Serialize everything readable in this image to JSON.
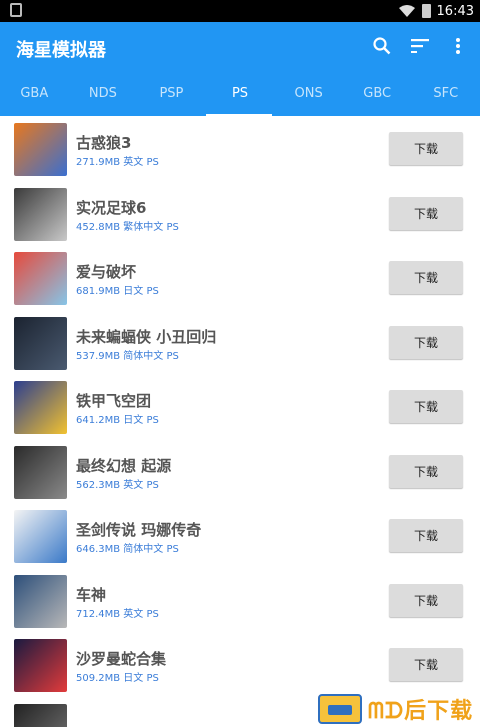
{
  "status": {
    "time": "16:43"
  },
  "appbar": {
    "title": "海星模拟器"
  },
  "tabs": [
    "GBA",
    "NDS",
    "PSP",
    "PS",
    "ONS",
    "GBC",
    "SFC"
  ],
  "active_tab": "PS",
  "games": [
    {
      "name": "古惑狼3",
      "meta": "271.9MB 英文 PS",
      "button": "下载",
      "thumb": [
        "#e8781e",
        "#3a6fd0"
      ]
    },
    {
      "name": "实况足球6",
      "meta": "452.8MB 繁体中文 PS",
      "button": "下载",
      "thumb": [
        "#3a3a3a",
        "#c9c9c9"
      ]
    },
    {
      "name": "爱与破坏",
      "meta": "681.9MB 日文 PS",
      "button": "下载",
      "thumb": [
        "#e64a3c",
        "#86c5e8"
      ]
    },
    {
      "name": "未来蝙蝠侠 小丑回归",
      "meta": "537.9MB 简体中文 PS",
      "button": "下载",
      "thumb": [
        "#1b2330",
        "#4a5a70"
      ]
    },
    {
      "name": "铁甲飞空团",
      "meta": "641.2MB 日文 PS",
      "button": "下载",
      "thumb": [
        "#2c3e8f",
        "#f2c230"
      ]
    },
    {
      "name": "最终幻想 起源",
      "meta": "562.3MB 英文 PS",
      "button": "下载",
      "thumb": [
        "#2a2a2a",
        "#8a8a8a"
      ]
    },
    {
      "name": "圣剑传说 玛娜传奇",
      "meta": "646.3MB 简体中文 PS",
      "button": "下载",
      "thumb": [
        "#f4f4f4",
        "#3a79c8"
      ]
    },
    {
      "name": "车神",
      "meta": "712.4MB 英文 PS",
      "button": "下载",
      "thumb": [
        "#2d4f7a",
        "#b8b8b8"
      ]
    },
    {
      "name": "沙罗曼蛇合集",
      "meta": "509.2MB 日文 PS",
      "button": "下载",
      "thumb": [
        "#1a1a40",
        "#e23b3b"
      ]
    },
    {
      "name": "",
      "meta": "",
      "button": "",
      "thumb": [
        "#222222",
        "#777777"
      ]
    }
  ],
  "watermark": {
    "text": "ᗰᗪ后下载"
  },
  "colors": {
    "appbar": "#2196f3",
    "meta_text": "#3b7dd8",
    "button_bg": "#dcdcdc"
  },
  "icons": [
    "search-icon",
    "sort-icon",
    "overflow-menu-icon",
    "wifi-icon",
    "battery-icon"
  ]
}
